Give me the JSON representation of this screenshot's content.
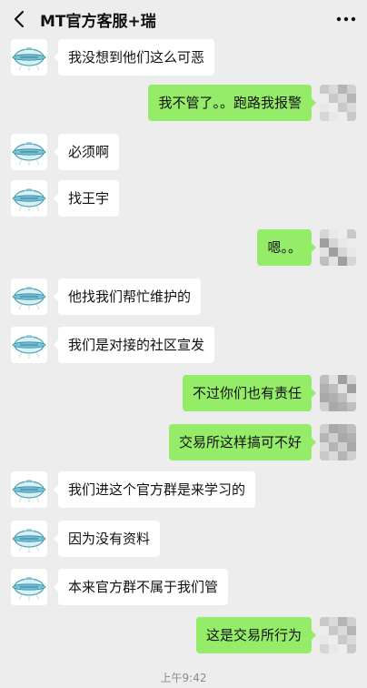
{
  "header": {
    "title": "MT官方客服+瑞",
    "back_icon": "chevron-left-icon",
    "more_icon": "ellipsis-icon"
  },
  "colors": {
    "background": "#ededed",
    "incoming_bubble": "#ffffff",
    "outgoing_bubble": "#95ec69",
    "timestamp_text": "#8a8a8a"
  },
  "messages": [
    {
      "side": "left",
      "text": "我没想到他们这么可恶"
    },
    {
      "side": "right",
      "text": "我不管了。。跑路我报警"
    },
    {
      "side": "left",
      "text": "必须啊"
    },
    {
      "side": "left",
      "text": "找王宇"
    },
    {
      "side": "right",
      "text": "嗯。。"
    },
    {
      "side": "left",
      "text": "他找我们帮忙维护的"
    },
    {
      "side": "left",
      "text": "我们是对接的社区宣发"
    },
    {
      "side": "right",
      "text": "不过你们也有责任"
    },
    {
      "side": "right",
      "text": "交易所这样搞可不好"
    },
    {
      "side": "left",
      "text": "我们进这个官方群是来学习的"
    },
    {
      "side": "left",
      "text": "因为没有资料"
    },
    {
      "side": "left",
      "text": "本来官方群不属于我们管"
    },
    {
      "side": "right",
      "text": "这是交易所行为"
    }
  ],
  "timestamp": "上午9:42"
}
